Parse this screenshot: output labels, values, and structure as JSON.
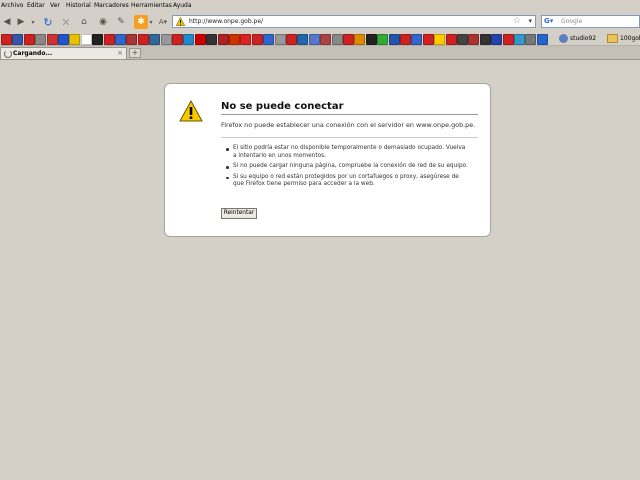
{
  "menu": [
    "Archivo",
    "Editar",
    "Ver",
    "Historial",
    "Marcadores",
    "Herramientas",
    "Ayuda"
  ],
  "address": {
    "url": "http://www.onpe.gob.pe/"
  },
  "search": {
    "placeholder": "Google",
    "engine_icon": "google-icon"
  },
  "bookmarks": {
    "icon_colors": [
      "#cc2222",
      "#3355aa",
      "#cc2222",
      "#888888",
      "#cc3333",
      "#2255cc",
      "#e8c000",
      "#ffffff",
      "#222222",
      "#cc2222",
      "#3366cc",
      "#aa3333",
      "#cc2222",
      "#336699",
      "#999999",
      "#cc2222",
      "#2288cc",
      "#cc0000",
      "#333333",
      "#aa2222",
      "#cc3300",
      "#dd2222",
      "#cc2222",
      "#3366cc",
      "#999999",
      "#cc2222",
      "#2266aa",
      "#5577cc",
      "#aa4444",
      "#888888",
      "#cc2222",
      "#dd8800",
      "#222222",
      "#33aa33",
      "#2255aa",
      "#cc2222",
      "#3366cc",
      "#cc2222",
      "#ffcc00",
      "#cc2222",
      "#444444",
      "#aa3333",
      "#333333",
      "#2244aa",
      "#cc2222",
      "#3399cc",
      "#777777",
      "#2266cc"
    ],
    "folders": [
      "studio92",
      "100goles"
    ]
  },
  "tab": {
    "title": "Cargando..."
  },
  "error": {
    "title": "No se puede conectar",
    "message": "Firefox no puede establecer una conexión con el servidor en www.onpe.gob.pe.",
    "items": [
      "El sitio podría estar no disponible temporalmente o demasiado ocupado. Vuelva a intentarlo en unos momentos.",
      "Si no puede cargar ninguna página, compruebe la conexión de red de su equipo.",
      "Si su equipo o red están protegidos por un cortafuegos o proxy, asegúrese de que Firefox tiene permiso para acceder a la web."
    ],
    "retry_label": "Reintentar"
  }
}
